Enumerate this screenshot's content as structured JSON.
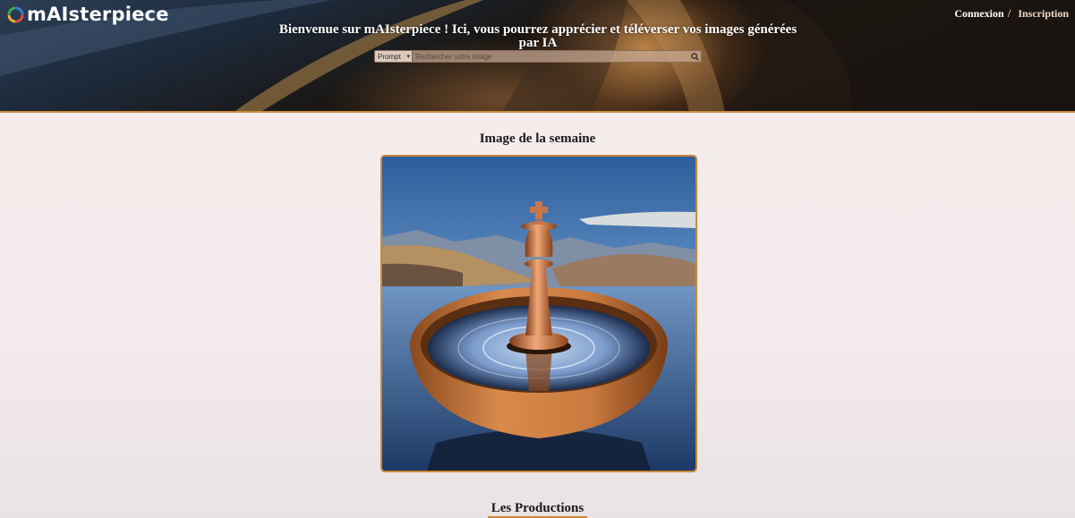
{
  "header": {
    "logo": {
      "text": "mAIsterpiece",
      "icon": "colorful-circle-logo"
    },
    "auth": {
      "login": "Connexion",
      "separator": "/",
      "signup": "Inscription"
    },
    "welcome": "Bienvenue sur mAIsterpiece ! Ici, vous pourrez apprécier et téléverser vos images générées par IA",
    "search": {
      "filter_selected": "Prompt",
      "placeholder": "Rechercher votre image",
      "button_icon": "search-icon"
    }
  },
  "main": {
    "week_title": "Image de la semaine",
    "featured_image": {
      "description_icon": "chess-king-in-bowl-artwork"
    },
    "productions_title": "Les Productions"
  },
  "colors": {
    "accent": "#c9893a",
    "page_background": "#f6eced",
    "header_text": "#ffffff"
  }
}
